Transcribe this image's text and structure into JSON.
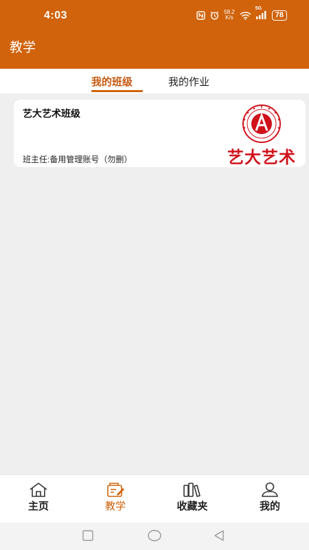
{
  "status_bar": {
    "time": "4:03",
    "speed_value": "58.2",
    "speed_unit": "K/s",
    "network": "5G",
    "battery": "78"
  },
  "header": {
    "title": "教学"
  },
  "tabs": [
    {
      "label": "我的班级",
      "active": true
    },
    {
      "label": "我的作业",
      "active": false
    }
  ],
  "classes": [
    {
      "name": "艺大艺术班级",
      "teacher": "班主任:备用管理账号（勿删）",
      "logo_text": "艺大艺术"
    }
  ],
  "bottom_nav": [
    {
      "label": "主页",
      "icon": "home-icon",
      "active": false
    },
    {
      "label": "教学",
      "icon": "teaching-icon",
      "active": true
    },
    {
      "label": "收藏夹",
      "icon": "favorites-icon",
      "active": false
    },
    {
      "label": "我的",
      "icon": "profile-icon",
      "active": false
    }
  ],
  "colors": {
    "brand": "#d0630b",
    "background": "#efefef",
    "logo_red": "#d0121b"
  }
}
